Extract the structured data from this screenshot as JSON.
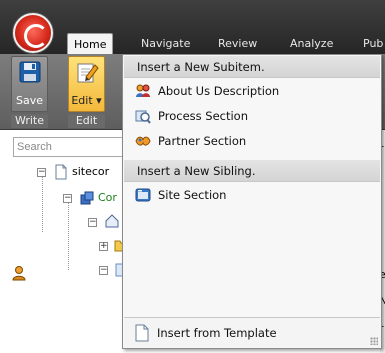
{
  "ribbon": {
    "tabs": [
      "Home",
      "Navigate",
      "Review",
      "Analyze",
      "Pub"
    ],
    "active_tab": "Home",
    "buttons": [
      {
        "label": "Save",
        "icon": "floppy-disk-icon",
        "group": "Write"
      },
      {
        "label": "Edit ▾",
        "icon": "edit-pencil-icon",
        "group": "Edit"
      }
    ],
    "groups": [
      "Write",
      "Edit"
    ]
  },
  "search": {
    "placeholder": "Search"
  },
  "tree": {
    "nodes": [
      {
        "label": "sitecor",
        "icon": "document-icon"
      },
      {
        "label": "Cor",
        "icon": "content-icon"
      }
    ]
  },
  "menu": {
    "header_subitem": "Insert a New Subitem.",
    "subitems": [
      {
        "label": "About Us Description",
        "icon": "people-icon"
      },
      {
        "label": "Process Section",
        "icon": "process-icon"
      },
      {
        "label": "Partner Section",
        "icon": "partner-icon"
      }
    ],
    "header_sibling": "Insert a New Sibling.",
    "siblings": [
      {
        "label": "Site Section",
        "icon": "site-section-icon"
      }
    ],
    "footer": {
      "label": "Insert from Template",
      "icon": "template-document-icon"
    }
  },
  "right_content": {
    "chars": [
      "r",
      "e",
      "N",
      "r"
    ]
  },
  "colors": {
    "ribbon_dark": "#2e2e2e",
    "pressed_button": "#f3b93c",
    "orb_red": "#d52a1c",
    "menu_bg": "#f7f7f7"
  }
}
